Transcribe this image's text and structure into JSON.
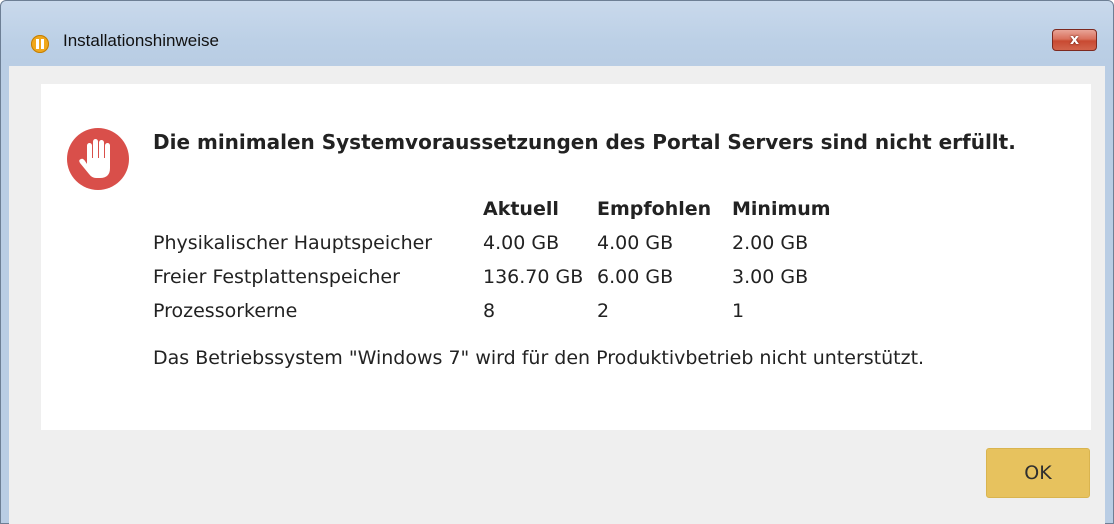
{
  "window": {
    "title": "Installationshinweise",
    "app_icon": "app-logo-icon",
    "close_label": "x"
  },
  "dialog": {
    "icon": "stop-hand-icon",
    "heading": "Die minimalen Systemvoraussetzungen des Portal Servers sind nicht erfüllt.",
    "table": {
      "headers": [
        "",
        "Aktuell",
        "Empfohlen",
        "Minimum"
      ],
      "rows": [
        [
          "Physikalischer Hauptspeicher",
          "4.00 GB",
          "4.00 GB",
          "2.00 GB"
        ],
        [
          "Freier Festplattenspeicher",
          "136.70 GB",
          "6.00 GB",
          "3.00 GB"
        ],
        [
          "Prozessorkerne",
          "8",
          "2",
          "1"
        ]
      ]
    },
    "os_note": "Das Betriebssystem \"Windows 7\" wird für den Produktivbetrieb nicht unterstützt.",
    "ok_label": "OK"
  },
  "colors": {
    "stop_icon": "#d94f4a",
    "ok_button": "#e7c25e",
    "close_button": "#c84a32"
  }
}
